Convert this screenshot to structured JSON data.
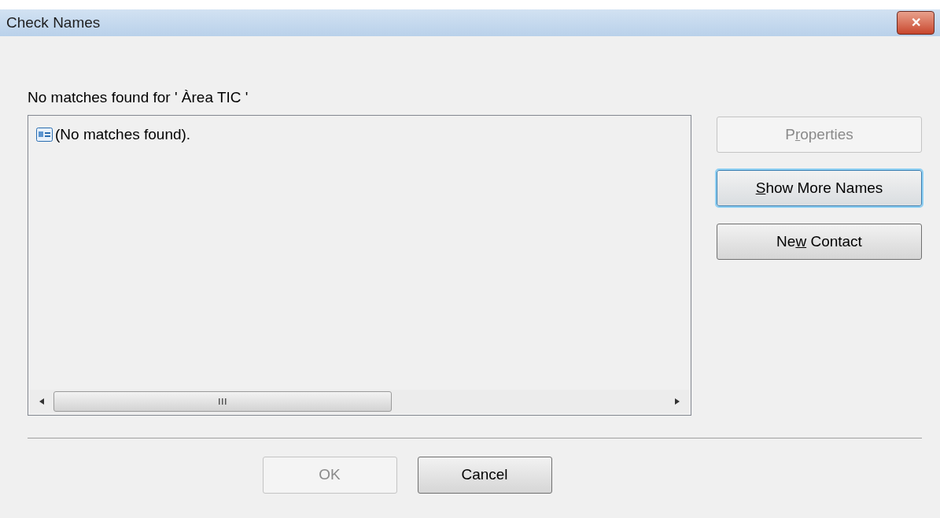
{
  "window": {
    "title": "Check Names",
    "close": "✕"
  },
  "message": "No matches found for ' Àrea TIC '",
  "results": [
    {
      "text": "(No matches found)."
    }
  ],
  "side_buttons": [
    {
      "before": "P",
      "mnemonic": "r",
      "after": "operties",
      "disabled": true,
      "focused": false
    },
    {
      "mnemonic": "S",
      "after": "how More Names",
      "disabled": false,
      "focused": true
    },
    {
      "before": "Ne",
      "mnemonic": "w",
      "after": " Contact",
      "disabled": false,
      "focused": false
    }
  ],
  "footer_buttons": [
    {
      "label": "OK",
      "disabled": true
    },
    {
      "label": "Cancel",
      "disabled": false
    }
  ]
}
